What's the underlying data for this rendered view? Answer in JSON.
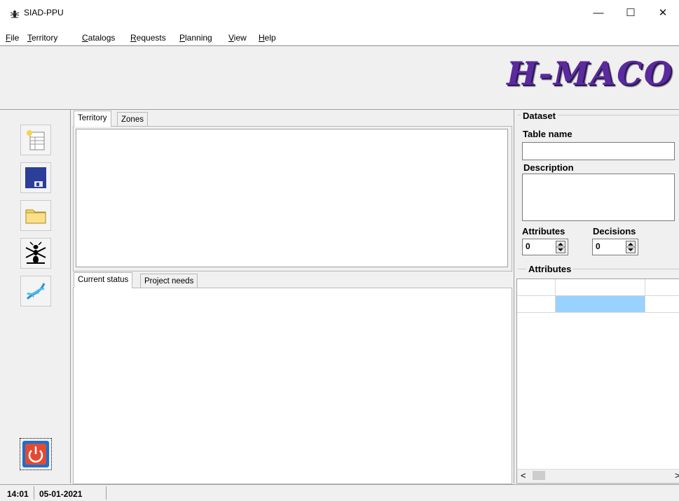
{
  "window": {
    "title": "SIAD-PPU",
    "minimize_glyph": "—",
    "maximize_glyph": "☐",
    "close_glyph": "✕"
  },
  "menu": {
    "items": [
      "File",
      "Territory",
      "Catalogs",
      "Requests",
      "Planning",
      "View",
      "Help"
    ]
  },
  "banner": {
    "logo_text": "H-MACO"
  },
  "toolbar": {
    "buttons": [
      "new-table-icon",
      "save-icon",
      "open-folder-icon",
      "ant-icon",
      "dna-icon"
    ],
    "exit": "power-icon"
  },
  "top_panel": {
    "tabs": [
      "Territory",
      "Zones"
    ],
    "active": "Territory"
  },
  "bottom_panel": {
    "tabs": [
      "Current status",
      "Project needs"
    ],
    "active": "Current status"
  },
  "dataset": {
    "group_label": "Dataset",
    "table_name_label": "Table name",
    "table_name_value": "",
    "description_label": "Description",
    "description_value": "",
    "attributes_label": "Attributes",
    "attributes_value": "0",
    "decisions_label": "Decisions",
    "decisions_value": "0"
  },
  "attributes_grid": {
    "group_label": "Attributes",
    "scroll_left": "<",
    "scroll_right": ">",
    "selected_cell_color": "#99d1ff"
  },
  "status": {
    "time": "14:01",
    "date": "05-01-2021"
  }
}
